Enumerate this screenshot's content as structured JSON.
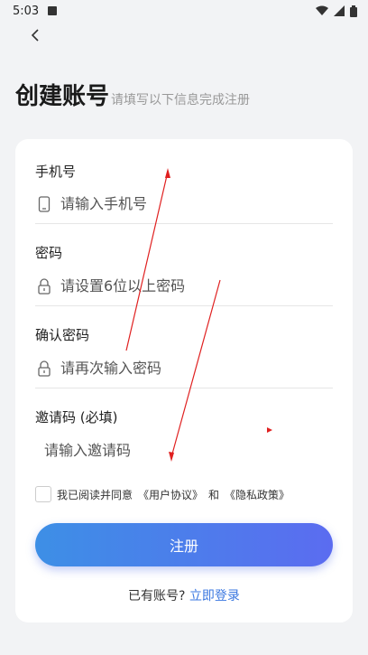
{
  "status_bar": {
    "time": "5:03"
  },
  "header": {
    "title": "创建账号",
    "subtitle": "请填写以下信息完成注册"
  },
  "form": {
    "phone": {
      "label": "手机号",
      "placeholder": "请输入手机号",
      "icon": "phone-icon"
    },
    "password": {
      "label": "密码",
      "placeholder": "请设置6位以上密码",
      "icon": "lock-icon"
    },
    "confirm": {
      "label": "确认密码",
      "placeholder": "请再次输入密码",
      "icon": "lock-icon"
    },
    "invite": {
      "label": "邀请码 (必填)",
      "placeholder": "请输入邀请码"
    }
  },
  "agreement": {
    "prefix": "我已阅读并同意",
    "user_agreement": "《用户协议》",
    "and": "和",
    "privacy_policy": "《隐私政策》",
    "checked": false
  },
  "register_button": {
    "label": "注册"
  },
  "login_prompt": {
    "text": "已有账号?",
    "link": "立即登录"
  },
  "colors": {
    "accent": "#3a77e0",
    "button_gradient_start": "#3d8fe6",
    "button_gradient_end": "#5b6cf0",
    "annotation": "#e02020"
  }
}
